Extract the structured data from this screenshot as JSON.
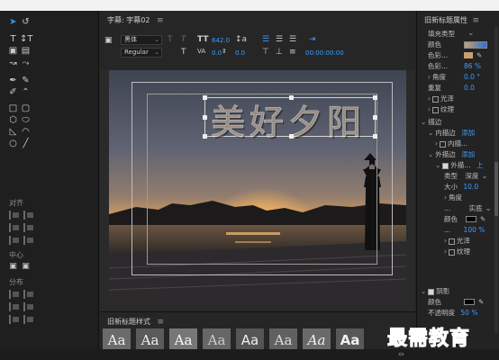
{
  "title_panel": {
    "label": "字幕: 字幕02",
    "menu": "≡"
  },
  "properties_panel": {
    "label": "旧新标题属性",
    "menu": "≡"
  },
  "styles_panel": {
    "label": "旧新标题样式",
    "menu": "≡",
    "swatch_text": "Aa"
  },
  "toolbar": {
    "font_family": "黑体",
    "font_style": "Regular",
    "font_size": "642.0",
    "kerning": "0.0",
    "leading": "0.0",
    "timecode": "00:00:00:00"
  },
  "tool_sections": {
    "align": "对齐",
    "center": "中心",
    "distribute": "分布"
  },
  "caption_text": "美好夕阳",
  "properties": {
    "fill_type": "填充类型",
    "color": "颜色",
    "color_stop": "色彩...",
    "color_stop_opacity": "色彩...",
    "color_stop_opacity_value": "86 %",
    "angle": "角度",
    "angle_value": "0.0 °",
    "repeat": "重复",
    "repeat_value": "0.0",
    "sheen": "光泽",
    "texture": "纹理",
    "stroke_group": "描边",
    "inner_stroke": "内描边",
    "add": "添加",
    "inner_stroke_item": "内描...",
    "outer_stroke": "外描边",
    "outer_stroke_item": "外描...",
    "up": "上",
    "type": "类型",
    "type_value": "深度",
    "size": "大小",
    "size_value": "10.0",
    "angle2": "角度",
    "fill_type2": "...",
    "fill_solid": "实底",
    "color2": "颜色",
    "opacity2": "...",
    "opacity2_value": "100 %",
    "sheen2": "光泽",
    "texture2": "纹理",
    "shadow": "阴影",
    "color3": "颜色",
    "shadow_opacity": "不透明度",
    "shadow_opacity_value": "50 %"
  },
  "watermark": "最需教育",
  "colors": {
    "accent": "#3b9cff",
    "gradient_left": "#c9a171",
    "gradient_right": "#2e6fd6",
    "stroke_swatch": "#000000"
  }
}
